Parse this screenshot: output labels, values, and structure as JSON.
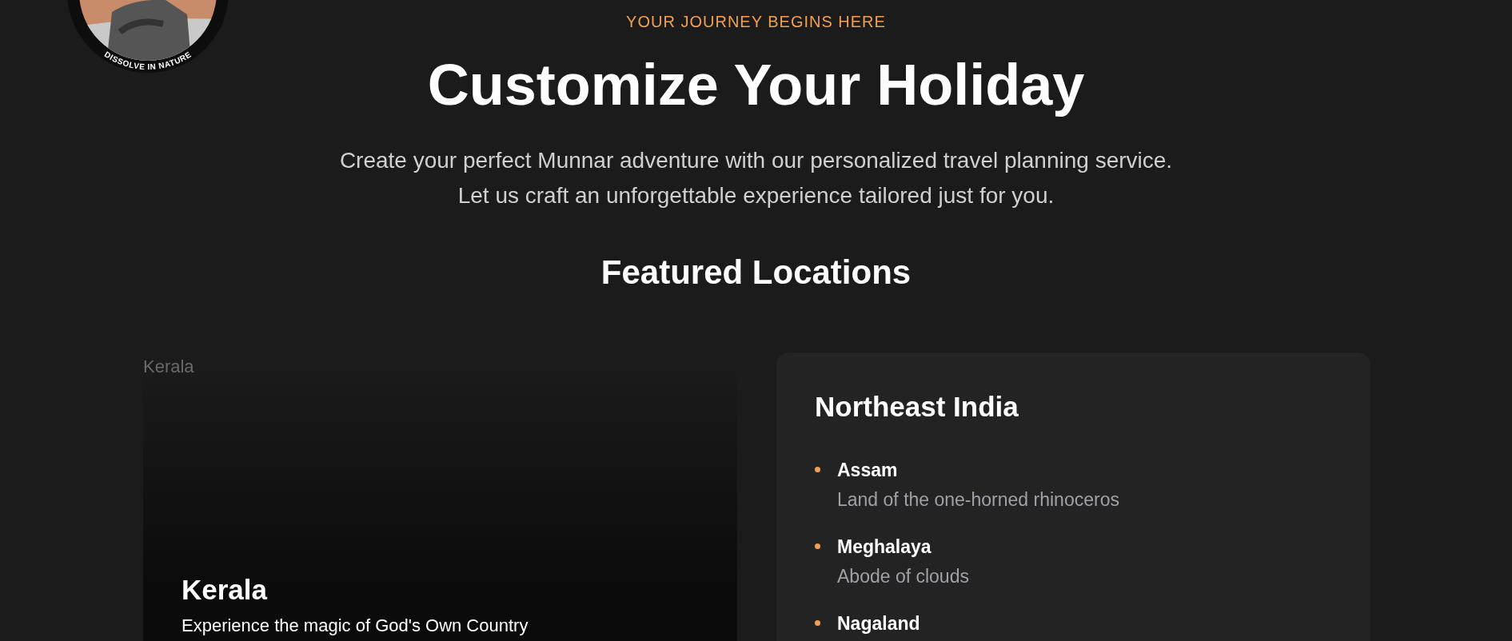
{
  "logo": {
    "caption": "DISSOLVE IN NATURE"
  },
  "hero": {
    "eyebrow": "YOUR JOURNEY BEGINS HERE",
    "title": "Customize Your Holiday",
    "subtitle_lines": [
      "Create your perfect Munnar adventure with our personalized travel planning service.",
      "Let us craft an unforgettable experience tailored just for you."
    ]
  },
  "featured": {
    "heading": "Featured Locations",
    "image_card": {
      "image_alt": "Kerala",
      "title": "Kerala",
      "description": "Experience the magic of God's Own Country"
    },
    "region_card": {
      "title": "Northeast India",
      "items": [
        {
          "name": "Assam",
          "description": "Land of the one-horned rhinoceros"
        },
        {
          "name": "Meghalaya",
          "description": "Abode of clouds"
        },
        {
          "name": "Nagaland"
        }
      ]
    }
  }
}
